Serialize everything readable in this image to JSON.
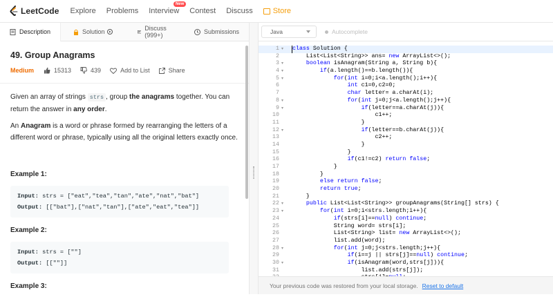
{
  "nav": {
    "logo_text": "LeetCode",
    "items": [
      "Explore",
      "Problems",
      "Interview",
      "Contest",
      "Discuss"
    ],
    "new_badge": "New",
    "store": "Store",
    "colors": {
      "store": "#f59e0b",
      "badge": "#ff4d4f"
    }
  },
  "tabs": {
    "description": "Description",
    "solution": "Solution",
    "discuss": "Discuss (999+)",
    "submissions": "Submissions"
  },
  "problem": {
    "title": "49. Group Anagrams",
    "difficulty": "Medium",
    "likes": "15313",
    "dislikes": "439",
    "add_to_list": "Add to List",
    "share": "Share",
    "desc1_a": "Given an array of strings ",
    "desc1_code": "strs",
    "desc1_b": ", group ",
    "desc1_bold": "the anagrams",
    "desc1_c": " together. You can return the answer in ",
    "desc1_bold2": "any order",
    "desc1_d": ".",
    "desc2_bold": "Anagram",
    "desc2_rest": " is a word or phrase formed by rearranging the letters of a different word or phrase, typically using all the original letters exactly once.",
    "desc2_prefix": "An ",
    "examples": [
      {
        "heading": "Example 1:",
        "input": "strs = [\"eat\",\"tea\",\"tan\",\"ate\",\"nat\",\"bat\"]",
        "output": "[[\"bat\"],[\"nat\",\"tan\"],[\"ate\",\"eat\",\"tea\"]]"
      },
      {
        "heading": "Example 2:",
        "input": "strs = [\"\"]",
        "output": "[[\"\"]]"
      },
      {
        "heading": "Example 3:"
      }
    ],
    "input_label": "Input:",
    "output_label": "Output:"
  },
  "editor": {
    "language": "Java",
    "autocomplete": "Autocomplete",
    "notice": "Your previous code was restored from your local storage.",
    "reset_link": "Reset to default",
    "lines": [
      {
        "n": "1",
        "f": true,
        "c": "class Solution {"
      },
      {
        "n": "2",
        "f": false,
        "c": "    List<List<String>> ans= new ArrayList<>();"
      },
      {
        "n": "3",
        "f": true,
        "c": "    boolean isAnagram(String a, String b){"
      },
      {
        "n": "4",
        "f": true,
        "c": "        if(a.length()==b.length()){"
      },
      {
        "n": "5",
        "f": true,
        "c": "            for(int i=0;i<a.length();i++){"
      },
      {
        "n": "6",
        "f": false,
        "c": "                int c1=0,c2=0;"
      },
      {
        "n": "7",
        "f": false,
        "c": "                char letter= a.charAt(i);"
      },
      {
        "n": "8",
        "f": true,
        "c": "                for(int j=0;j<a.length();j++){"
      },
      {
        "n": "9",
        "f": true,
        "c": "                    if(letter==a.charAt(j)){"
      },
      {
        "n": "10",
        "f": false,
        "c": "                        c1++;"
      },
      {
        "n": "11",
        "f": false,
        "c": "                    }"
      },
      {
        "n": "12",
        "f": true,
        "c": "                    if(letter==b.charAt(j)){"
      },
      {
        "n": "13",
        "f": false,
        "c": "                        c2++;"
      },
      {
        "n": "14",
        "f": false,
        "c": "                    }"
      },
      {
        "n": "15",
        "f": false,
        "c": "                }"
      },
      {
        "n": "16",
        "f": false,
        "c": "                if(c1!=c2) return false;"
      },
      {
        "n": "17",
        "f": false,
        "c": "            }"
      },
      {
        "n": "18",
        "f": false,
        "c": "        }"
      },
      {
        "n": "19",
        "f": false,
        "c": "        else return false;"
      },
      {
        "n": "20",
        "f": false,
        "c": "        return true;"
      },
      {
        "n": "21",
        "f": false,
        "c": "    }"
      },
      {
        "n": "22",
        "f": true,
        "c": "    public List<List<String>> groupAnagrams(String[] strs) {"
      },
      {
        "n": "23",
        "f": true,
        "c": "        for(int i=0;i<strs.length;i++){"
      },
      {
        "n": "24",
        "f": false,
        "c": "            if(strs[i]==null) continue;"
      },
      {
        "n": "25",
        "f": false,
        "c": "            String word= strs[i];"
      },
      {
        "n": "26",
        "f": false,
        "c": "            List<String> list= new ArrayList<>();"
      },
      {
        "n": "27",
        "f": false,
        "c": "            list.add(word);"
      },
      {
        "n": "28",
        "f": true,
        "c": "            for(int j=0;j<strs.length;j++){"
      },
      {
        "n": "29",
        "f": false,
        "c": "                if(i==j || strs[j]==null) continue;"
      },
      {
        "n": "30",
        "f": true,
        "c": "                if(isAnagram(word,strs[j])){"
      },
      {
        "n": "31",
        "f": false,
        "c": "                    list.add(strs[j]);"
      },
      {
        "n": "32",
        "f": false,
        "c": "                    strs[j]=null;"
      }
    ]
  }
}
